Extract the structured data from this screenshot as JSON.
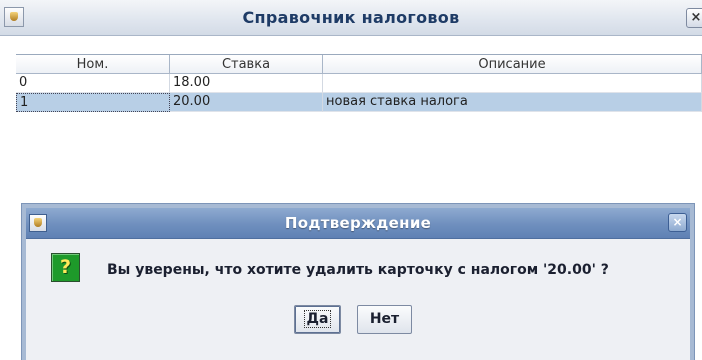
{
  "window": {
    "title": "Справочник налоговов",
    "close_label": "×"
  },
  "table": {
    "headers": [
      "Ном.",
      "Ставка",
      "Описание"
    ],
    "rows": [
      {
        "num": "0",
        "rate": "18.00",
        "desc": ""
      },
      {
        "num": "1",
        "rate": "20.00",
        "desc": "новая ставка налога",
        "selected": true
      }
    ]
  },
  "dialog": {
    "title": "Подтверждение",
    "close_label": "×",
    "question_icon_glyph": "?",
    "message": "Вы уверены, что хотите удалить карточку с налогом '20.00' ?",
    "yes_label": "Да",
    "no_label": "Нет"
  },
  "colors": {
    "selection": "#b8cfe6",
    "dialog_title_bar": "#6f8fbe",
    "question_icon": "#1e9a2a"
  }
}
